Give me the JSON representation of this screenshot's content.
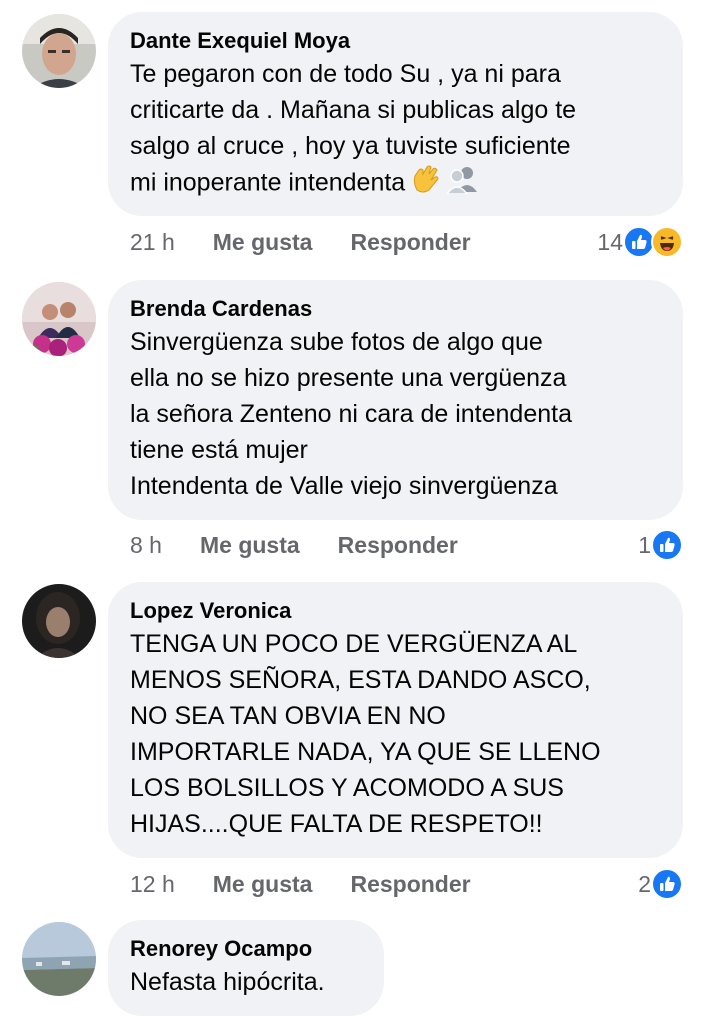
{
  "comments": [
    {
      "author": "Dante Exequiel Moya",
      "text": "Te pegaron con de todo Su , ya ni para\ncriticarte da . Mañana si publicas algo te\nsalgo al cruce , hoy ya tuviste suficiente\nmi inoperante intendenta",
      "emojis": [
        "waving-hand-icon",
        "busts-icon"
      ],
      "time": "21 h",
      "like_label": "Me gusta",
      "reply_label": "Responder",
      "reaction_count": "14",
      "reactions": [
        "like",
        "haha"
      ]
    },
    {
      "author": "Brenda Cardenas",
      "text": "Sinvergüenza sube fotos de algo que\nella no se hizo presente una vergüenza\nla  señora Zenteno ni cara de intendenta\ntiene está mujer\nIntendenta de Valle viejo sinvergüenza",
      "time": "8 h",
      "like_label": "Me gusta",
      "reply_label": "Responder",
      "reaction_count": "1",
      "reactions": [
        "like"
      ]
    },
    {
      "author": "Lopez Veronica",
      "text": "TENGA UN POCO DE VERGÜENZA AL\nMENOS SEÑORA, ESTA DANDO ASCO,\nNO SEA TAN OBVIA EN NO\nIMPORTARLE NADA, YA QUE SE LLENO\nLOS BOLSILLOS Y ACOMODO A SUS\nHIJAS....QUE FALTA DE RESPETO!!",
      "time": "12 h",
      "like_label": "Me gusta",
      "reply_label": "Responder",
      "reaction_count": "2",
      "reactions": [
        "like"
      ]
    },
    {
      "author": "Renorey Ocampo",
      "text": "Nefasta hipócrita.",
      "time": "",
      "like_label": "",
      "reply_label": "",
      "reaction_count": "",
      "reactions": []
    }
  ],
  "colors": {
    "bubble": "#f0f2f5",
    "meta": "#65676b",
    "like_blue": "#1877f2",
    "haha_yellow": "#f7b928"
  }
}
